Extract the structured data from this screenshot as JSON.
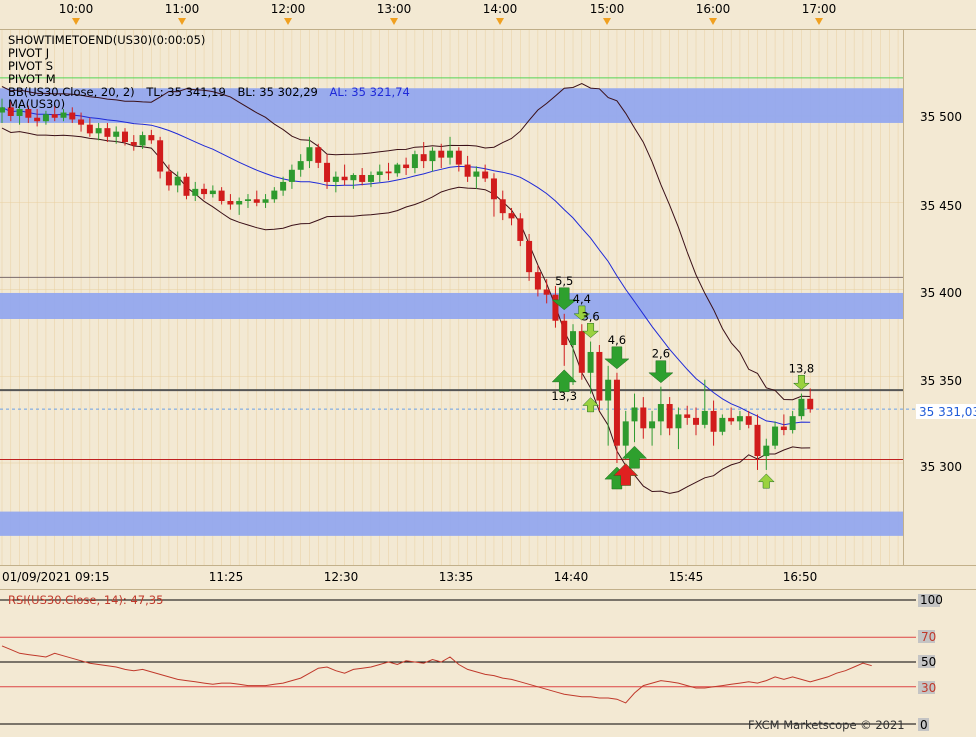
{
  "colors": {
    "background": "#f3e9d3",
    "grid": "#e8cfa0",
    "zone_fill": "#93a8ee",
    "bb_lines": "#3a1018",
    "bb_mid": "#1f2ad8",
    "rsi_line": "#c0392b",
    "candle_up": "#2e9a2e",
    "candle_down": "#d11c1c",
    "arrow_green": "#2ea02e",
    "arrow_light": "#9ad23f",
    "arrow_red": "#e02020"
  },
  "top_time_axis": [
    "10:00",
    "11:00",
    "12:00",
    "13:00",
    "14:00",
    "15:00",
    "16:00",
    "17:00"
  ],
  "indicator_labels": {
    "line1": "SHOWTIMETOEND(US30)(0:00:05)",
    "line2": "PIVOT J",
    "line3": "PIVOT S",
    "line4": "PIVOT M",
    "bb_prefix": "BB(US30.Close, 20, 2)",
    "bb_tl": "TL: 35 341,19",
    "bb_bl": "BL: 35 302,29",
    "bb_al": "AL: 35 321,74",
    "sma_label": "MA(US30)"
  },
  "rsi_label": "RSI(US30.Close, 14): 47,35",
  "watermark": "FXCM Marketscope © 2021",
  "bottom_time_axis": [
    "01/09/2021 09:15",
    "11:25",
    "12:30",
    "13:35",
    "14:40",
    "15:45",
    "16:50"
  ],
  "price_axis_ticks": [
    "35 500",
    "35 450",
    "35 400",
    "35 350",
    "35 300"
  ],
  "current_price_label": "35 331,03",
  "rsi_axis_ticks": [
    "100",
    "70",
    "50",
    "30",
    "0"
  ],
  "chart_data": {
    "type": "candlestick",
    "title": "US30",
    "price_range": [
      35250,
      35535
    ],
    "price_ticks": [
      35300,
      35350,
      35400,
      35450,
      35500
    ],
    "current_price": 35331.03,
    "bollinger": {
      "period": 20,
      "dev": 2,
      "top": 35341.19,
      "bottom": 35302.29,
      "mid": 35321.74
    },
    "horizontal_lines": [
      {
        "price": 35522,
        "color": "#55d455"
      },
      {
        "price": 35407,
        "color": "#7a6a6a"
      },
      {
        "price": 35342,
        "color": "#555555"
      },
      {
        "price": 35302,
        "color": "#c02020"
      }
    ],
    "zones": [
      {
        "from": 35496,
        "to": 35516
      },
      {
        "from": 35383,
        "to": 35398
      },
      {
        "from": 35258,
        "to": 35272
      }
    ],
    "candles": [
      {
        "t": "09:15",
        "o": 35502,
        "h": 35510,
        "l": 35496,
        "c": 35505
      },
      {
        "t": "09:20",
        "o": 35505,
        "h": 35509,
        "l": 35497,
        "c": 35500
      },
      {
        "t": "09:25",
        "o": 35500,
        "h": 35507,
        "l": 35495,
        "c": 35504
      },
      {
        "t": "09:30",
        "o": 35504,
        "h": 35506,
        "l": 35496,
        "c": 35499
      },
      {
        "t": "09:35",
        "o": 35499,
        "h": 35504,
        "l": 35494,
        "c": 35497
      },
      {
        "t": "09:40",
        "o": 35497,
        "h": 35503,
        "l": 35495,
        "c": 35501
      },
      {
        "t": "09:45",
        "o": 35501,
        "h": 35506,
        "l": 35497,
        "c": 35499
      },
      {
        "t": "09:50",
        "o": 35499,
        "h": 35504,
        "l": 35497,
        "c": 35502
      },
      {
        "t": "09:55",
        "o": 35502,
        "h": 35505,
        "l": 35496,
        "c": 35498
      },
      {
        "t": "10:00",
        "o": 35498,
        "h": 35502,
        "l": 35491,
        "c": 35495
      },
      {
        "t": "10:05",
        "o": 35495,
        "h": 35499,
        "l": 35488,
        "c": 35490
      },
      {
        "t": "10:10",
        "o": 35490,
        "h": 35496,
        "l": 35486,
        "c": 35493
      },
      {
        "t": "10:15",
        "o": 35493,
        "h": 35496,
        "l": 35485,
        "c": 35488
      },
      {
        "t": "10:20",
        "o": 35488,
        "h": 35494,
        "l": 35484,
        "c": 35491
      },
      {
        "t": "10:25",
        "o": 35491,
        "h": 35493,
        "l": 35483,
        "c": 35485
      },
      {
        "t": "10:30",
        "o": 35485,
        "h": 35489,
        "l": 35480,
        "c": 35483
      },
      {
        "t": "10:35",
        "o": 35483,
        "h": 35491,
        "l": 35481,
        "c": 35489
      },
      {
        "t": "10:40",
        "o": 35489,
        "h": 35492,
        "l": 35484,
        "c": 35486
      },
      {
        "t": "10:45",
        "o": 35486,
        "h": 35488,
        "l": 35464,
        "c": 35468
      },
      {
        "t": "10:50",
        "o": 35468,
        "h": 35472,
        "l": 35457,
        "c": 35460
      },
      {
        "t": "10:55",
        "o": 35460,
        "h": 35468,
        "l": 35456,
        "c": 35465
      },
      {
        "t": "11:00",
        "o": 35465,
        "h": 35467,
        "l": 35452,
        "c": 35454
      },
      {
        "t": "11:05",
        "o": 35454,
        "h": 35462,
        "l": 35451,
        "c": 35458
      },
      {
        "t": "11:10",
        "o": 35458,
        "h": 35461,
        "l": 35452,
        "c": 35455
      },
      {
        "t": "11:15",
        "o": 35455,
        "h": 35460,
        "l": 35453,
        "c": 35457
      },
      {
        "t": "11:20",
        "o": 35457,
        "h": 35459,
        "l": 35449,
        "c": 35451
      },
      {
        "t": "11:25",
        "o": 35451,
        "h": 35455,
        "l": 35446,
        "c": 35449
      },
      {
        "t": "11:30",
        "o": 35449,
        "h": 35453,
        "l": 35443,
        "c": 35451
      },
      {
        "t": "11:35",
        "o": 35451,
        "h": 35455,
        "l": 35447,
        "c": 35452
      },
      {
        "t": "11:40",
        "o": 35452,
        "h": 35457,
        "l": 35448,
        "c": 35450
      },
      {
        "t": "11:45",
        "o": 35450,
        "h": 35455,
        "l": 35447,
        "c": 35452
      },
      {
        "t": "11:50",
        "o": 35452,
        "h": 35459,
        "l": 35450,
        "c": 35457
      },
      {
        "t": "11:55",
        "o": 35457,
        "h": 35465,
        "l": 35454,
        "c": 35462
      },
      {
        "t": "12:00",
        "o": 35462,
        "h": 35472,
        "l": 35458,
        "c": 35469
      },
      {
        "t": "12:05",
        "o": 35469,
        "h": 35478,
        "l": 35465,
        "c": 35474
      },
      {
        "t": "12:10",
        "o": 35474,
        "h": 35488,
        "l": 35470,
        "c": 35482
      },
      {
        "t": "12:15",
        "o": 35482,
        "h": 35484,
        "l": 35470,
        "c": 35473
      },
      {
        "t": "12:20",
        "o": 35473,
        "h": 35478,
        "l": 35458,
        "c": 35462
      },
      {
        "t": "12:25",
        "o": 35462,
        "h": 35468,
        "l": 35456,
        "c": 35465
      },
      {
        "t": "12:30",
        "o": 35465,
        "h": 35472,
        "l": 35460,
        "c": 35463
      },
      {
        "t": "12:35",
        "o": 35463,
        "h": 35467,
        "l": 35458,
        "c": 35466
      },
      {
        "t": "12:40",
        "o": 35466,
        "h": 35470,
        "l": 35460,
        "c": 35462
      },
      {
        "t": "12:45",
        "o": 35462,
        "h": 35468,
        "l": 35459,
        "c": 35466
      },
      {
        "t": "12:50",
        "o": 35466,
        "h": 35472,
        "l": 35462,
        "c": 35468
      },
      {
        "t": "12:55",
        "o": 35468,
        "h": 35473,
        "l": 35463,
        "c": 35467
      },
      {
        "t": "13:00",
        "o": 35467,
        "h": 35473,
        "l": 35465,
        "c": 35472
      },
      {
        "t": "13:05",
        "o": 35472,
        "h": 35476,
        "l": 35466,
        "c": 35470
      },
      {
        "t": "13:10",
        "o": 35470,
        "h": 35480,
        "l": 35467,
        "c": 35478
      },
      {
        "t": "13:15",
        "o": 35478,
        "h": 35485,
        "l": 35470,
        "c": 35474
      },
      {
        "t": "13:20",
        "o": 35474,
        "h": 35482,
        "l": 35468,
        "c": 35480
      },
      {
        "t": "13:25",
        "o": 35480,
        "h": 35484,
        "l": 35470,
        "c": 35476
      },
      {
        "t": "13:30",
        "o": 35476,
        "h": 35488,
        "l": 35472,
        "c": 35480
      },
      {
        "t": "13:35",
        "o": 35480,
        "h": 35482,
        "l": 35468,
        "c": 35472
      },
      {
        "t": "13:40",
        "o": 35472,
        "h": 35477,
        "l": 35462,
        "c": 35465
      },
      {
        "t": "13:45",
        "o": 35465,
        "h": 35471,
        "l": 35458,
        "c": 35468
      },
      {
        "t": "13:50",
        "o": 35468,
        "h": 35472,
        "l": 35462,
        "c": 35464
      },
      {
        "t": "13:55",
        "o": 35464,
        "h": 35467,
        "l": 35442,
        "c": 35452
      },
      {
        "t": "14:00",
        "o": 35452,
        "h": 35457,
        "l": 35440,
        "c": 35444
      },
      {
        "t": "14:05",
        "o": 35444,
        "h": 35447,
        "l": 35437,
        "c": 35441
      },
      {
        "t": "14:10",
        "o": 35441,
        "h": 35444,
        "l": 35425,
        "c": 35428
      },
      {
        "t": "14:15",
        "o": 35428,
        "h": 35432,
        "l": 35405,
        "c": 35410
      },
      {
        "t": "14:20",
        "o": 35410,
        "h": 35414,
        "l": 35396,
        "c": 35400
      },
      {
        "t": "14:25",
        "o": 35400,
        "h": 35406,
        "l": 35392,
        "c": 35397
      },
      {
        "t": "14:30",
        "o": 35397,
        "h": 35402,
        "l": 35378,
        "c": 35382
      },
      {
        "t": "14:35",
        "o": 35382,
        "h": 35386,
        "l": 35356,
        "c": 35368
      },
      {
        "t": "14:40",
        "o": 35368,
        "h": 35380,
        "l": 35345,
        "c": 35376
      },
      {
        "t": "14:45",
        "o": 35376,
        "h": 35380,
        "l": 35348,
        "c": 35352
      },
      {
        "t": "14:50",
        "o": 35352,
        "h": 35370,
        "l": 35340,
        "c": 35364
      },
      {
        "t": "14:55",
        "o": 35364,
        "h": 35368,
        "l": 35330,
        "c": 35336
      },
      {
        "t": "15:00",
        "o": 35336,
        "h": 35356,
        "l": 35310,
        "c": 35348
      },
      {
        "t": "15:05",
        "o": 35348,
        "h": 35352,
        "l": 35300,
        "c": 35310
      },
      {
        "t": "15:10",
        "o": 35310,
        "h": 35330,
        "l": 35302,
        "c": 35324
      },
      {
        "t": "15:15",
        "o": 35324,
        "h": 35340,
        "l": 35312,
        "c": 35332
      },
      {
        "t": "15:20",
        "o": 35332,
        "h": 35338,
        "l": 35314,
        "c": 35320
      },
      {
        "t": "15:25",
        "o": 35320,
        "h": 35330,
        "l": 35310,
        "c": 35324
      },
      {
        "t": "15:30",
        "o": 35324,
        "h": 35344,
        "l": 35316,
        "c": 35334
      },
      {
        "t": "15:35",
        "o": 35334,
        "h": 35338,
        "l": 35316,
        "c": 35320
      },
      {
        "t": "15:40",
        "o": 35320,
        "h": 35332,
        "l": 35308,
        "c": 35328
      },
      {
        "t": "15:45",
        "o": 35328,
        "h": 35333,
        "l": 35322,
        "c": 35326
      },
      {
        "t": "15:50",
        "o": 35326,
        "h": 35332,
        "l": 35316,
        "c": 35322
      },
      {
        "t": "15:55",
        "o": 35322,
        "h": 35348,
        "l": 35320,
        "c": 35330
      },
      {
        "t": "16:00",
        "o": 35330,
        "h": 35336,
        "l": 35310,
        "c": 35318
      },
      {
        "t": "16:05",
        "o": 35318,
        "h": 35328,
        "l": 35316,
        "c": 35326
      },
      {
        "t": "16:10",
        "o": 35326,
        "h": 35332,
        "l": 35322,
        "c": 35324
      },
      {
        "t": "16:15",
        "o": 35324,
        "h": 35330,
        "l": 35319,
        "c": 35327
      },
      {
        "t": "16:20",
        "o": 35327,
        "h": 35330,
        "l": 35320,
        "c": 35322
      },
      {
        "t": "16:25",
        "o": 35322,
        "h": 35328,
        "l": 35296,
        "c": 35304
      },
      {
        "t": "16:30",
        "o": 35304,
        "h": 35314,
        "l": 35296,
        "c": 35310
      },
      {
        "t": "16:35",
        "o": 35310,
        "h": 35324,
        "l": 35308,
        "c": 35321
      },
      {
        "t": "16:40",
        "o": 35321,
        "h": 35328,
        "l": 35316,
        "c": 35319
      },
      {
        "t": "16:45",
        "o": 35319,
        "h": 35330,
        "l": 35317,
        "c": 35327
      },
      {
        "t": "16:50",
        "o": 35327,
        "h": 35340,
        "l": 35325,
        "c": 35337
      },
      {
        "t": "16:55",
        "o": 35337,
        "h": 35343,
        "l": 35329,
        "c": 35331
      }
    ],
    "signals": [
      {
        "t": "14:35",
        "dir": "down",
        "kind": "strong",
        "label": "5,5"
      },
      {
        "t": "14:45",
        "dir": "down",
        "kind": "light",
        "label": "4,4"
      },
      {
        "t": "14:50",
        "dir": "down",
        "kind": "light",
        "label": "3,6"
      },
      {
        "t": "15:05",
        "dir": "down",
        "kind": "strong",
        "label": "4,6"
      },
      {
        "t": "15:30",
        "dir": "down",
        "kind": "strong",
        "label": "2,6"
      },
      {
        "t": "16:50",
        "dir": "down",
        "kind": "light",
        "label": "13,8"
      },
      {
        "t": "14:35",
        "dir": "up",
        "kind": "strong",
        "label": "13,3"
      },
      {
        "t": "14:50",
        "dir": "up",
        "kind": "light",
        "label": ""
      },
      {
        "t": "15:05",
        "dir": "up",
        "kind": "strong",
        "label": ""
      },
      {
        "t": "15:10",
        "dir": "up",
        "kind": "red",
        "label": ""
      },
      {
        "t": "15:15",
        "dir": "up",
        "kind": "strong",
        "label": ""
      },
      {
        "t": "16:30",
        "dir": "up",
        "kind": "light",
        "label": ""
      }
    ],
    "rsi": {
      "period": 14,
      "last": 47.35,
      "levels": [
        100,
        70,
        50,
        30,
        0
      ],
      "values": [
        63,
        60,
        57,
        56,
        55,
        54,
        57,
        55,
        53,
        51,
        49,
        48,
        47,
        46,
        44,
        43,
        44,
        42,
        40,
        38,
        36,
        35,
        34,
        33,
        32,
        33,
        33,
        32,
        31,
        31,
        31,
        32,
        33,
        35,
        37,
        41,
        45,
        46,
        43,
        41,
        44,
        45,
        46,
        48,
        50,
        48,
        51,
        50,
        49,
        52,
        50,
        54,
        48,
        44,
        42,
        40,
        39,
        37,
        36,
        34,
        32,
        30,
        28,
        26,
        24,
        23,
        22,
        22,
        21,
        21,
        20,
        17,
        25,
        31,
        33,
        35,
        34,
        33,
        31,
        29,
        29,
        30,
        31,
        32,
        33,
        34,
        33,
        35,
        38,
        36,
        38,
        36,
        34,
        36,
        38,
        41,
        43,
        46,
        49,
        47
      ]
    }
  }
}
